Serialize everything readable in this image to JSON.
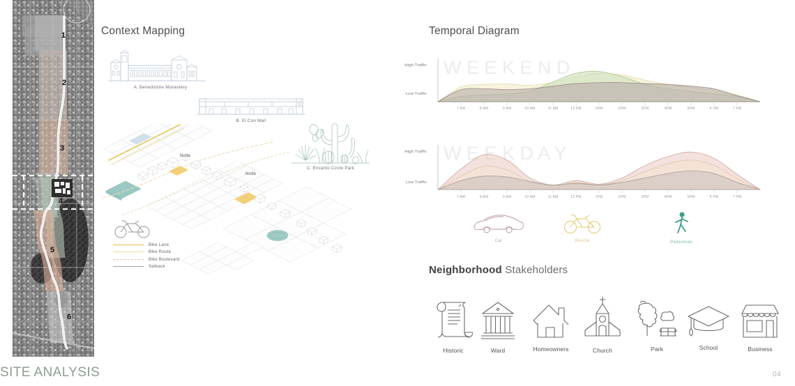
{
  "footer": {
    "title": "SITE ANALYSIS",
    "page_number": "04",
    "title_color": "#8e9e92"
  },
  "site_map": {
    "name": "aerial-site-corridor",
    "segments": [
      "1",
      "2",
      "3",
      "4",
      "5",
      "6"
    ],
    "segment_colors": [
      "#b9b9b9",
      "#cbbdb4",
      "#d8b8a4",
      "#b4c2b6",
      "#dcb098",
      "#c6c6c6"
    ]
  },
  "context_mapping": {
    "heading": "Context Mapping",
    "illustrations": [
      {
        "id": "monastery",
        "caption": "A. Benedictine Monastery",
        "color": "#b9c6d2"
      },
      {
        "id": "mall",
        "caption": "B. El Con Mall",
        "color": "#b9c6d2"
      },
      {
        "id": "park",
        "caption": "C. Encanto Circle Park",
        "color": "#9dbfae"
      }
    ],
    "node_labels": [
      "Node",
      "Node"
    ],
    "legend": {
      "icon": "bicycle-icon",
      "items": [
        {
          "label": "Bike Lane",
          "color": "#e0b94a",
          "style": "solid"
        },
        {
          "label": "Bike Route",
          "color": "#ecd9a8",
          "style": "solid"
        },
        {
          "label": "Bike Boulevard",
          "color": "#e3c79a",
          "style": "dashed"
        },
        {
          "label": "Setback",
          "color": "#9aa3ab",
          "style": "solid"
        }
      ]
    }
  },
  "temporal": {
    "heading": "Temporal Diagram",
    "mode_legend": [
      {
        "label": "Car",
        "icon": "car-icon",
        "color": "#b9969c"
      },
      {
        "label": "Bicycle",
        "icon": "bicycle-icon",
        "color": "#e3c766"
      },
      {
        "label": "Pedestrian",
        "icon": "pedestrian-icon",
        "color": "#3f9b8c"
      }
    ]
  },
  "stakeholders": {
    "heading_bold": "Neighborhood",
    "heading_light": " Stakeholders",
    "items": [
      {
        "label": "Historic",
        "icon": "scroll-icon"
      },
      {
        "label": "Ward",
        "icon": "courthouse-icon"
      },
      {
        "label": "Homeowners",
        "icon": "house-icon"
      },
      {
        "label": "Church",
        "icon": "church-icon"
      },
      {
        "label": "Park",
        "icon": "tree-bench-icon"
      },
      {
        "label": "School",
        "icon": "graduation-cap-icon"
      },
      {
        "label": "Business",
        "icon": "storefront-icon"
      }
    ]
  },
  "chart_data": [
    {
      "type": "area",
      "id": "weekend",
      "title": "WEEKEND",
      "watermark": "W E E K E N D",
      "xlabel": "",
      "ylabel": "",
      "ytick_labels": [
        "High Traffic",
        "Low Traffic"
      ],
      "ylim": [
        0,
        100
      ],
      "grid": false,
      "legend_position": "below",
      "x": [
        "7 AM",
        "8 AM",
        "9 AM",
        "10 AM",
        "11 AM",
        "12 PM",
        "1PM",
        "2PM",
        "3PM",
        "4PM",
        "5PM",
        "6 PM",
        "7 PM"
      ],
      "series": [
        {
          "name": "Bicycle",
          "color": "#f2ecc8",
          "line_color": "#ded6a4",
          "values": [
            34,
            40,
            41,
            38,
            45,
            58,
            66,
            62,
            50,
            40,
            33,
            26,
            16
          ]
        },
        {
          "name": "Pedestrian",
          "color": "#cfe0bf",
          "line_color": "#9ec389",
          "values": [
            12,
            16,
            18,
            24,
            46,
            66,
            70,
            58,
            40,
            30,
            24,
            18,
            12
          ]
        },
        {
          "name": "Car",
          "color": "#b9aeab",
          "line_color": "#8d7f7d",
          "values": [
            28,
            30,
            28,
            30,
            36,
            42,
            44,
            44,
            42,
            40,
            36,
            30,
            14
          ]
        }
      ]
    },
    {
      "type": "area",
      "id": "weekday",
      "title": "WEEKDAY",
      "watermark": "W E E K D A Y",
      "xlabel": "",
      "ylabel": "",
      "ytick_labels": [
        "High Traffic",
        "Low Traffic"
      ],
      "ylim": [
        0,
        100
      ],
      "grid": false,
      "legend_position": "below",
      "x": [
        "7 AM",
        "8 AM",
        "9 AM",
        "10 AM",
        "11 AM",
        "12 PM",
        "1PM",
        "2PM",
        "3PM",
        "4PM",
        "5PM",
        "6 PM",
        "7 PM"
      ],
      "series": [
        {
          "name": "Car",
          "color": "#eccfc9",
          "line_color": "#c99e96",
          "values": [
            46,
            78,
            66,
            26,
            10,
            20,
            12,
            26,
            54,
            74,
            84,
            70,
            34
          ]
        },
        {
          "name": "Bicycle",
          "color": "#f6e2d2",
          "line_color": "#e0c3a8",
          "values": [
            30,
            52,
            44,
            18,
            8,
            16,
            10,
            20,
            40,
            58,
            66,
            54,
            24
          ]
        },
        {
          "name": "Pedestrian",
          "color": "#cbc4c0",
          "line_color": "#9b938f",
          "values": [
            20,
            30,
            28,
            18,
            10,
            14,
            10,
            16,
            26,
            36,
            42,
            36,
            16
          ]
        }
      ]
    }
  ]
}
